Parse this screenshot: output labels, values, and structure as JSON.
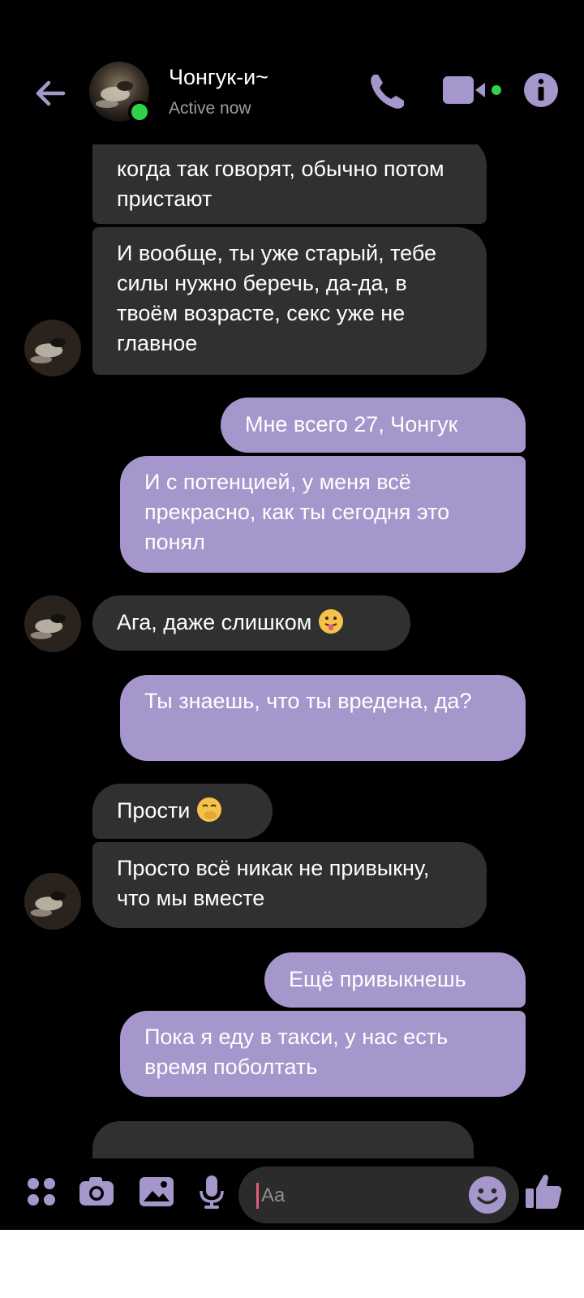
{
  "header": {
    "back_icon": "arrow-left-icon",
    "contact_name": "Чонгук-и~",
    "status": "Active now",
    "accent_color": "#a597cb",
    "presence_color": "#31d24a"
  },
  "messages": [
    {
      "from": "contact",
      "text": "когда так говорят, обычно потом пристают"
    },
    {
      "from": "contact",
      "text": "И вообще, ты уже старый, тебе силы нужно беречь, да-да, в твоём возрасте, секс уже не главное"
    },
    {
      "from": "me",
      "text": "Мне всего 27, Чонгук"
    },
    {
      "from": "me",
      "text": "И с потенцией, у меня всё прекрасно, как ты сегодня это понял"
    },
    {
      "from": "contact",
      "text": "Ага, даже слишком",
      "emoji": "tongue-out-emoji"
    },
    {
      "from": "me",
      "text": "Ты знаешь, что ты вредена, да?"
    },
    {
      "from": "contact",
      "text": "Прости",
      "emoji": "hand-over-mouth-emoji"
    },
    {
      "from": "contact",
      "text": "Просто всё никак не привыкну, что мы вместе"
    },
    {
      "from": "me",
      "text": "Ещё привыкнешь"
    },
    {
      "from": "me",
      "text": "Пока я еду в такси, у нас есть время поболтать"
    }
  ],
  "composer": {
    "placeholder": "Aa",
    "icons": [
      "menu-dots-icon",
      "camera-icon",
      "gallery-icon",
      "microphone-icon",
      "emoji-icon",
      "thumbs-up-icon"
    ]
  },
  "colors": {
    "incoming_bubble": "#303030",
    "outgoing_bubble": "#a597cb",
    "background": "#000000"
  }
}
